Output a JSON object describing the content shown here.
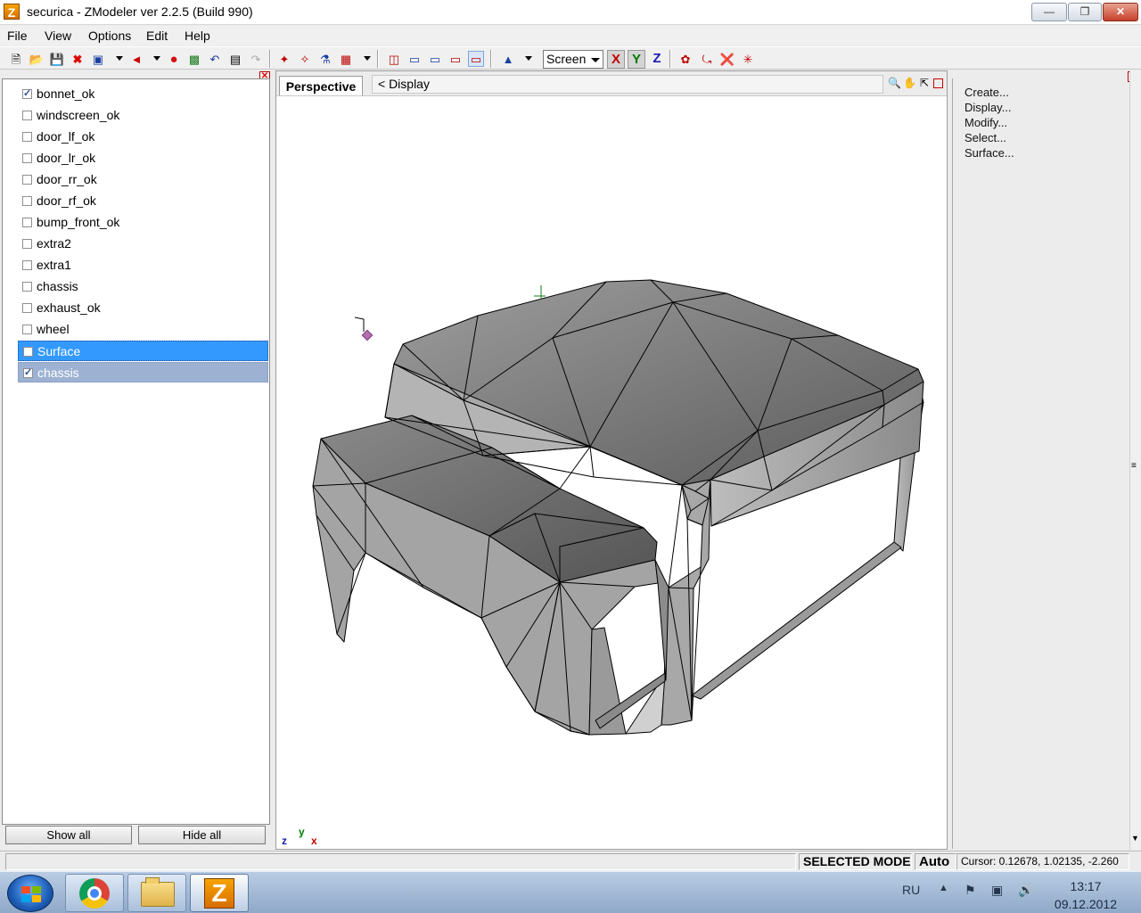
{
  "window": {
    "app_icon_letter": "Z",
    "title": "securica - ZModeler ver 2.2.5 (Build 990)",
    "minimize_icon": "minimize-icon",
    "restore_icon": "restore-icon",
    "close_icon": "close-icon"
  },
  "menu": {
    "file": "File",
    "view": "View",
    "options": "Options",
    "edit": "Edit",
    "help": "Help"
  },
  "toolbar": {
    "view_select": "Screen",
    "axis_x": "X",
    "axis_y": "Y",
    "axis_z": "Z",
    "axis_x_color": "#c00000",
    "axis_y_color": "#007a00",
    "axis_z_color": "#1a1ab0"
  },
  "objects": {
    "items": [
      {
        "label": "bonnet_ok",
        "check": "✓"
      },
      {
        "label": "windscreen_ok",
        "check": ""
      },
      {
        "label": "door_lf_ok",
        "check": ""
      },
      {
        "label": "door_lr_ok",
        "check": ""
      },
      {
        "label": "door_rr_ok",
        "check": ""
      },
      {
        "label": "door_rf_ok",
        "check": ""
      },
      {
        "label": "bump_front_ok",
        "check": ""
      },
      {
        "label": "extra2",
        "check": ""
      },
      {
        "label": "extra1",
        "check": ""
      },
      {
        "label": "chassis",
        "check": ""
      },
      {
        "label": "exhaust_ok",
        "check": ""
      },
      {
        "label": "wheel",
        "check": ""
      },
      {
        "label": "Surface",
        "check": ""
      },
      {
        "label": "chassis",
        "check": "✓"
      }
    ],
    "show_all": "Show all",
    "hide_all": "Hide all"
  },
  "viewport": {
    "tab": "Perspective",
    "display_path": "<  Display",
    "axis_z": "z",
    "axis_y": "y",
    "axis_x": "x"
  },
  "commands": {
    "items": [
      "Create...",
      "Display...",
      "Modify...",
      "Select...",
      "Surface..."
    ]
  },
  "status": {
    "mode": "SELECTED MODE",
    "auto": "Auto",
    "cursor": "Cursor: 0.12678, 1.02135, -2.260"
  },
  "taskbar": {
    "apps": [
      "chrome-icon",
      "explorer-icon",
      "zmodeler-icon"
    ],
    "zmodeler_letter": "Z",
    "language": "RU",
    "time": "13:17",
    "date": "09.12.2012"
  }
}
